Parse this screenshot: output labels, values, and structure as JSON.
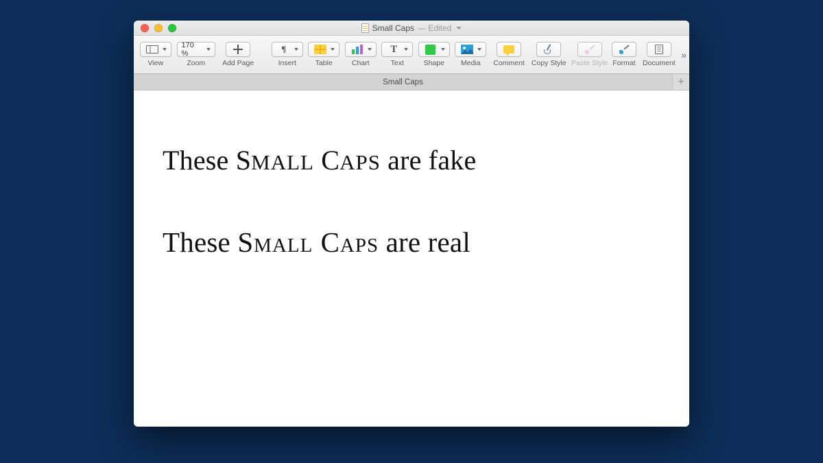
{
  "titlebar": {
    "doc_name": "Small Caps",
    "status": "— Edited"
  },
  "toolbar": {
    "view": {
      "label": "View"
    },
    "zoom": {
      "label": "Zoom",
      "value": "170 %"
    },
    "add_page": {
      "label": "Add Page"
    },
    "insert": {
      "label": "Insert"
    },
    "table": {
      "label": "Table"
    },
    "chart": {
      "label": "Chart"
    },
    "text": {
      "label": "Text"
    },
    "shape": {
      "label": "Shape"
    },
    "media": {
      "label": "Media"
    },
    "comment": {
      "label": "Comment"
    },
    "copy_style": {
      "label": "Copy Style"
    },
    "paste_style": {
      "label": "Paste Style"
    },
    "format": {
      "label": "Format"
    },
    "document": {
      "label": "Document"
    }
  },
  "tabs": {
    "active": "Small Caps"
  },
  "body": {
    "line1_pre": "These ",
    "line1_sc_a": "S",
    "line1_sc_b": "MALL",
    "line1_sc_c": " C",
    "line1_sc_d": "APS",
    "line1_post": " are fake",
    "line2_pre": "These ",
    "line2_sc": "Small Caps",
    "line2_post": " are real"
  }
}
